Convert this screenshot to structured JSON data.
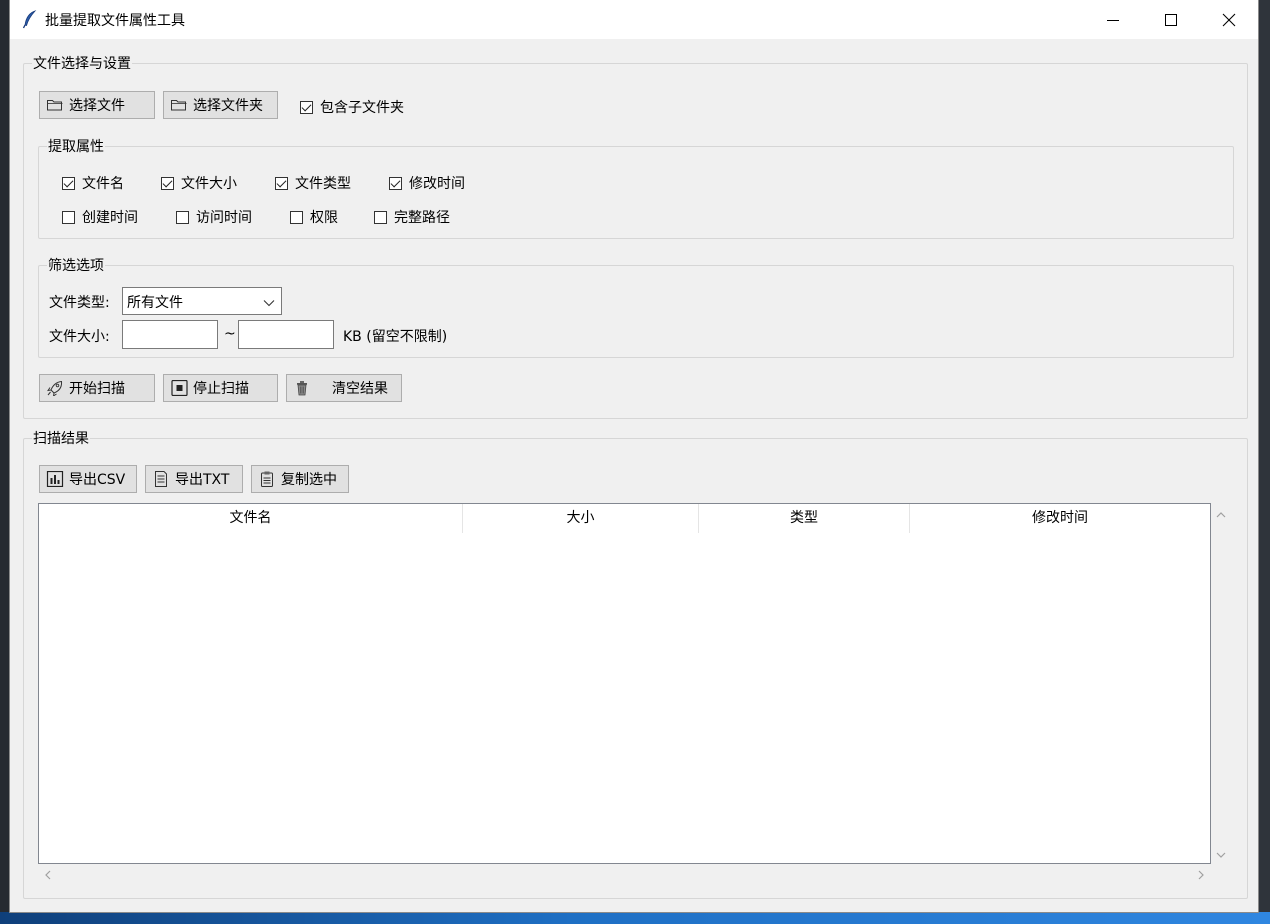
{
  "window": {
    "title": "批量提取文件属性工具"
  },
  "file_settings": {
    "legend": "文件选择与设置",
    "select_files_label": "选择文件",
    "select_folder_label": "选择文件夹",
    "include_subfolders": {
      "label": "包含子文件夹",
      "checked": true
    }
  },
  "attributes": {
    "legend": "提取属性",
    "items": [
      {
        "label": "文件名",
        "checked": true
      },
      {
        "label": "文件大小",
        "checked": true
      },
      {
        "label": "文件类型",
        "checked": true
      },
      {
        "label": "修改时间",
        "checked": true
      },
      {
        "label": "创建时间",
        "checked": false
      },
      {
        "label": "访问时间",
        "checked": false
      },
      {
        "label": "权限",
        "checked": false
      },
      {
        "label": "完整路径",
        "checked": false
      }
    ]
  },
  "filters": {
    "legend": "筛选选项",
    "file_type_label": "文件类型:",
    "file_type_value": "所有文件",
    "file_size_label": "文件大小:",
    "size_min": "",
    "size_sep": "~",
    "size_max": "",
    "size_unit_note": "KB (留空不限制)"
  },
  "actions": {
    "start_label": "开始扫描",
    "stop_label": "停止扫描",
    "clear_label": "清空结果"
  },
  "results": {
    "legend": "扫描结果",
    "export_csv_label": "导出CSV",
    "export_txt_label": "导出TXT",
    "copy_selected_label": "复制选中",
    "columns": [
      "文件名",
      "大小",
      "类型",
      "修改时间"
    ],
    "rows": []
  },
  "icons": {
    "app": "feather-icon",
    "folder": "folder-icon",
    "rocket": "rocket-icon",
    "stop": "stop-icon",
    "trash": "trash-icon",
    "chart": "bar-chart-icon",
    "text": "document-icon",
    "clipboard": "clipboard-icon"
  }
}
